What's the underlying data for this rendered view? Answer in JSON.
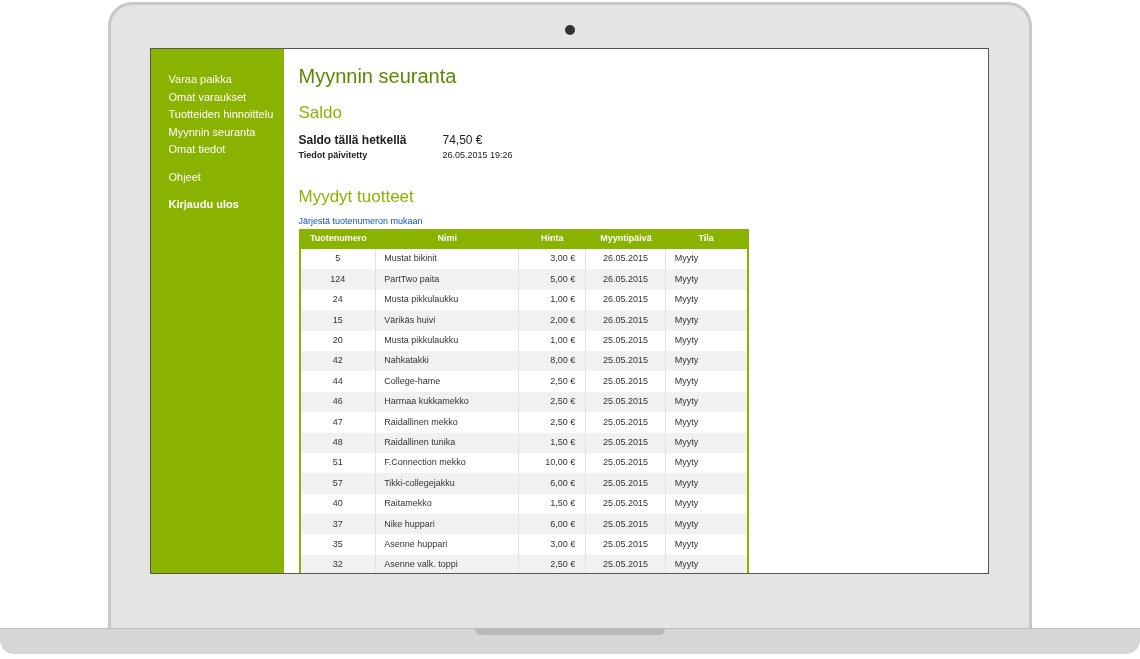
{
  "sidebar": {
    "groups": [
      [
        {
          "label": "Varaa paikka",
          "bold": false
        },
        {
          "label": "Omat varaukset",
          "bold": false
        },
        {
          "label": "Tuotteiden hinnoittelu",
          "bold": false
        },
        {
          "label": "Myynnin seuranta",
          "bold": false
        },
        {
          "label": "Omat tiedot",
          "bold": false
        }
      ],
      [
        {
          "label": "Ohjeet",
          "bold": false
        }
      ],
      [
        {
          "label": "Kirjaudu ulos",
          "bold": true
        }
      ]
    ]
  },
  "page_title": "Myynnin seuranta",
  "balance": {
    "heading": "Saldo",
    "rows": [
      {
        "label": "Saldo tällä hetkellä",
        "value": "74,50 €",
        "kind": "main"
      },
      {
        "label": "Tiedot päivitetty",
        "value": "26.05.2015 19:26",
        "kind": "minor"
      }
    ]
  },
  "sold": {
    "heading": "Myydyt tuotteet",
    "sort_link": "Järjestä tuotenumeron mukaan",
    "table": {
      "columns": [
        "Tuotenumero",
        "Nimi",
        "Hinta",
        "Myyntipäivä",
        "Tila"
      ],
      "rows": [
        [
          "5",
          "Mustat bikinit",
          "3,00 €",
          "26.05.2015",
          "Myyty"
        ],
        [
          "124",
          "PartTwo paita",
          "5,00 €",
          "26.05.2015",
          "Myyty"
        ],
        [
          "24",
          "Musta pikkulaukku",
          "1,00 €",
          "26.05.2015",
          "Myyty"
        ],
        [
          "15",
          "Värikäs huivi",
          "2,00 €",
          "26.05.2015",
          "Myyty"
        ],
        [
          "20",
          "Musta pikkulaukku",
          "1,00 €",
          "25.05.2015",
          "Myyty"
        ],
        [
          "42",
          "Nahkatakki",
          "8,00 €",
          "25.05.2015",
          "Myyty"
        ],
        [
          "44",
          "College-hame",
          "2,50 €",
          "25.05.2015",
          "Myyty"
        ],
        [
          "46",
          "Harmaa kukkamekko",
          "2,50 €",
          "25.05.2015",
          "Myyty"
        ],
        [
          "47",
          "Raidallinen mekko",
          "2,50 €",
          "25.05.2015",
          "Myyty"
        ],
        [
          "48",
          "Raidallinen tunika",
          "1,50 €",
          "25.05.2015",
          "Myyty"
        ],
        [
          "51",
          "F.Connection mekko",
          "10,00 €",
          "25.05.2015",
          "Myyty"
        ],
        [
          "57",
          "Tikki-collegejakku",
          "6,00 €",
          "25.05.2015",
          "Myyty"
        ],
        [
          "40",
          "Raitamekko",
          "1,50 €",
          "25.05.2015",
          "Myyty"
        ],
        [
          "37",
          "Nike huppari",
          "6,00 €",
          "25.05.2015",
          "Myyty"
        ],
        [
          "35",
          "Asenne huppari",
          "3,00 €",
          "25.05.2015",
          "Myyty"
        ],
        [
          "32",
          "Asenne valk. toppi",
          "2,50 €",
          "25.05.2015",
          "Myyty"
        ]
      ]
    }
  }
}
